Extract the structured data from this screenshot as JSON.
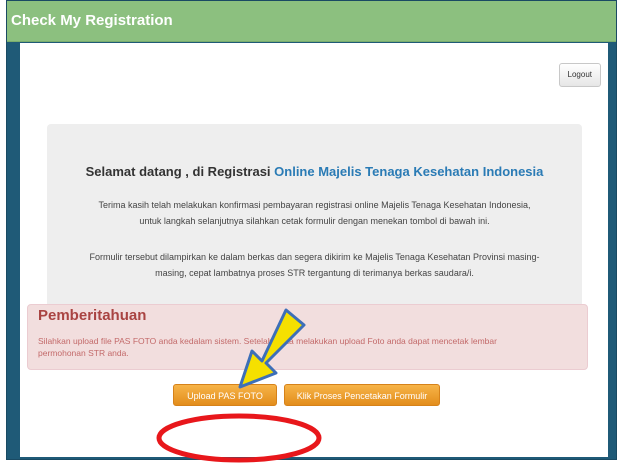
{
  "header": {
    "title": "Check My Registration"
  },
  "toolbar": {
    "logout_label": "Logout"
  },
  "welcome": {
    "heading_prefix": "Selamat datang , di Registrasi ",
    "heading_highlight": "Online Majelis Tenaga Kesehatan Indonesia",
    "paragraph1": "Terima kasih telah melakukan konfirmasi pembayaran registrasi online Majelis Tenaga Kesehatan Indonesia, untuk langkah selanjutnya silahkan cetak formulir dengan menekan tombol di bawah ini.",
    "paragraph2": "Formulir tersebut dilampirkan ke dalam berkas dan segera dikirim ke Majelis Tenaga Kesehatan Provinsi masing-masing, cepat lambatnya proses STR tergantung di terimanya berkas saudara/i."
  },
  "notice": {
    "title": "Pemberitahuan",
    "text": "Silahkan upload file PAS FOTO anda kedalam sistem. Setelah anda melakukan upload Foto anda dapat mencetak lembar permohonan STR anda."
  },
  "actions": {
    "upload_label": "Upload PAS FOTO",
    "print_label": "Klik Proses Pencetakan Formulir"
  },
  "colors": {
    "title_bar": "#8cc07f",
    "frame": "#1f5a77",
    "highlight_link": "#2a7bb5",
    "notice_title": "#a94442",
    "button_orange": "#f0a030",
    "annotation_arrow": "#f5e000",
    "annotation_ring": "#e8171b"
  },
  "annotations": {
    "arrow": "yellow-arrow-icon",
    "ring": "red-ellipse-highlight"
  }
}
